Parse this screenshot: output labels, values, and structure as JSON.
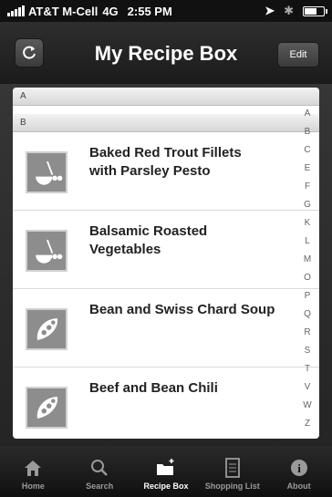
{
  "status_bar": {
    "carrier": "AT&T M-Cell",
    "network": "4G",
    "time": "2:55 PM"
  },
  "nav": {
    "title": "My Recipe Box",
    "edit_label": "Edit"
  },
  "sections": [
    {
      "letter": "A"
    },
    {
      "letter": "B"
    }
  ],
  "recipes": [
    {
      "title": "Baked Red Trout Fillets with Parsley Pesto",
      "icon": "bowl-icon"
    },
    {
      "title": "Balsamic Roasted Vegetables",
      "icon": "bowl-icon"
    },
    {
      "title": "Bean and Swiss Chard Soup",
      "icon": "pea-pod-icon"
    },
    {
      "title": "Beef and Bean Chili",
      "icon": "pea-pod-icon"
    }
  ],
  "index_letters": [
    "A",
    "B",
    "C",
    "E",
    "F",
    "G",
    "K",
    "L",
    "M",
    "O",
    "P",
    "Q",
    "R",
    "S",
    "T",
    "V",
    "W",
    "Z"
  ],
  "tabs": [
    {
      "label": "Home",
      "icon": "home-icon",
      "active": false
    },
    {
      "label": "Search",
      "icon": "search-icon",
      "active": false
    },
    {
      "label": "Recipe Box",
      "icon": "recipe-box-icon",
      "active": true
    },
    {
      "label": "Shopping List",
      "icon": "shopping-list-icon",
      "active": false
    },
    {
      "label": "About",
      "icon": "info-icon",
      "active": false
    }
  ]
}
